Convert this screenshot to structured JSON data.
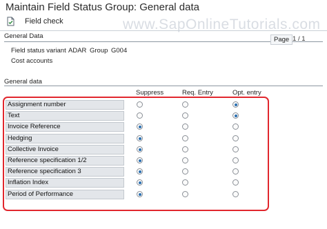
{
  "window": {
    "title": "Maintain Field Status Group: General data"
  },
  "watermark": "www.SapOnlineTutorials.com",
  "toolbar": {
    "field_check_label": "Field check",
    "field_check_icon": "document-check-icon"
  },
  "header_group": {
    "title": "General Data",
    "page_label": "Page",
    "page_current": "1",
    "page_total": "1",
    "fields": [
      {
        "label": "Field status variant",
        "value": "ADAR"
      },
      {
        "label": "Group",
        "value": "G004"
      }
    ],
    "description": "Cost accounts"
  },
  "general_data": {
    "title": "General data",
    "columns": [
      "Suppress",
      "Req. Entry",
      "Opt. entry"
    ],
    "rows": [
      {
        "label": "Assignment number",
        "selected": "Opt. entry"
      },
      {
        "label": "Text",
        "selected": "Opt. entry"
      },
      {
        "label": "Invoice Reference",
        "selected": "Suppress"
      },
      {
        "label": "Hedging",
        "selected": "Suppress"
      },
      {
        "label": "Collective Invoice",
        "selected": "Suppress"
      },
      {
        "label": "Reference specification 1/2",
        "selected": "Suppress"
      },
      {
        "label": "Reference specification 3",
        "selected": "Suppress"
      },
      {
        "label": "Inflation Index",
        "selected": "Suppress"
      },
      {
        "label": "Period of Performance",
        "selected": "Suppress"
      }
    ]
  },
  "colors": {
    "highlight_border": "#e1262d",
    "radio_selected": "#2a6fb0",
    "label_cell_bg": "#e3e6ea"
  }
}
